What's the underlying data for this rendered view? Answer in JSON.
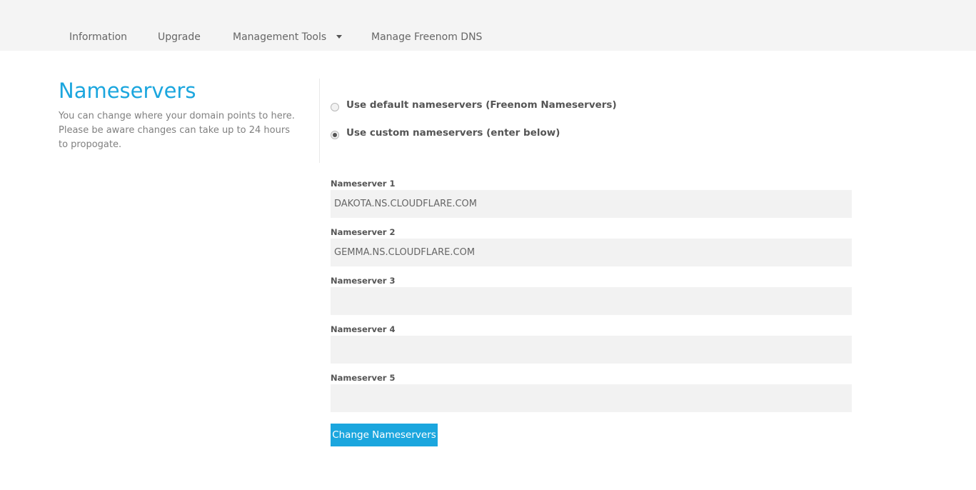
{
  "nav": {
    "items": [
      {
        "label": "Information"
      },
      {
        "label": "Upgrade"
      },
      {
        "label": "Management Tools",
        "icon": "caret-down-icon"
      },
      {
        "label": "Manage Freenom DNS"
      }
    ]
  },
  "page": {
    "title": "Nameservers",
    "description": "You can change where your domain points to here. Please be aware changes can take up to 24 hours to propogate."
  },
  "options": {
    "default_label": "Use default nameservers (Freenom Nameservers)",
    "custom_label": "Use custom nameservers (enter below)",
    "selected": "custom"
  },
  "nameservers": [
    {
      "label": "Nameserver 1",
      "value": "DAKOTA.NS.CLOUDFLARE.COM"
    },
    {
      "label": "Nameserver 2",
      "value": "GEMMA.NS.CLOUDFLARE.COM"
    },
    {
      "label": "Nameserver 3",
      "value": ""
    },
    {
      "label": "Nameserver 4",
      "value": ""
    },
    {
      "label": "Nameserver 5",
      "value": ""
    }
  ],
  "submit_label": "Change Nameservers",
  "colors": {
    "accent": "#1ba6de",
    "nav_bg": "#f4f4f4",
    "input_bg": "#f2f2f2"
  }
}
